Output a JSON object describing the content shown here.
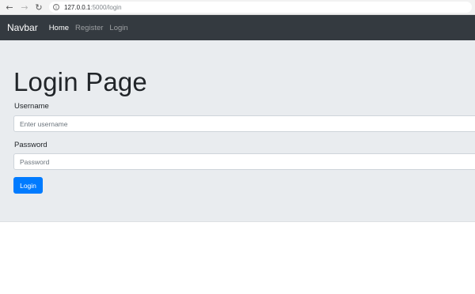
{
  "browser": {
    "back_icon": "arrow-left-icon",
    "forward_icon": "arrow-right-icon",
    "reload_icon": "reload-icon",
    "url_host": "127.0.0.1",
    "url_rest": ":5000/login"
  },
  "navbar": {
    "brand": "Navbar",
    "links": [
      {
        "label": "Home",
        "active": true
      },
      {
        "label": "Register",
        "active": false
      },
      {
        "label": "Login",
        "active": false
      }
    ],
    "background": "#343a40"
  },
  "main": {
    "title": "Login Page",
    "username_label": "Username",
    "username_placeholder": "Enter username",
    "username_value": "",
    "password_label": "Password",
    "password_placeholder": "Password",
    "password_value": "",
    "submit_label": "Login",
    "background": "#e9ecef",
    "accent": "#007bff"
  }
}
